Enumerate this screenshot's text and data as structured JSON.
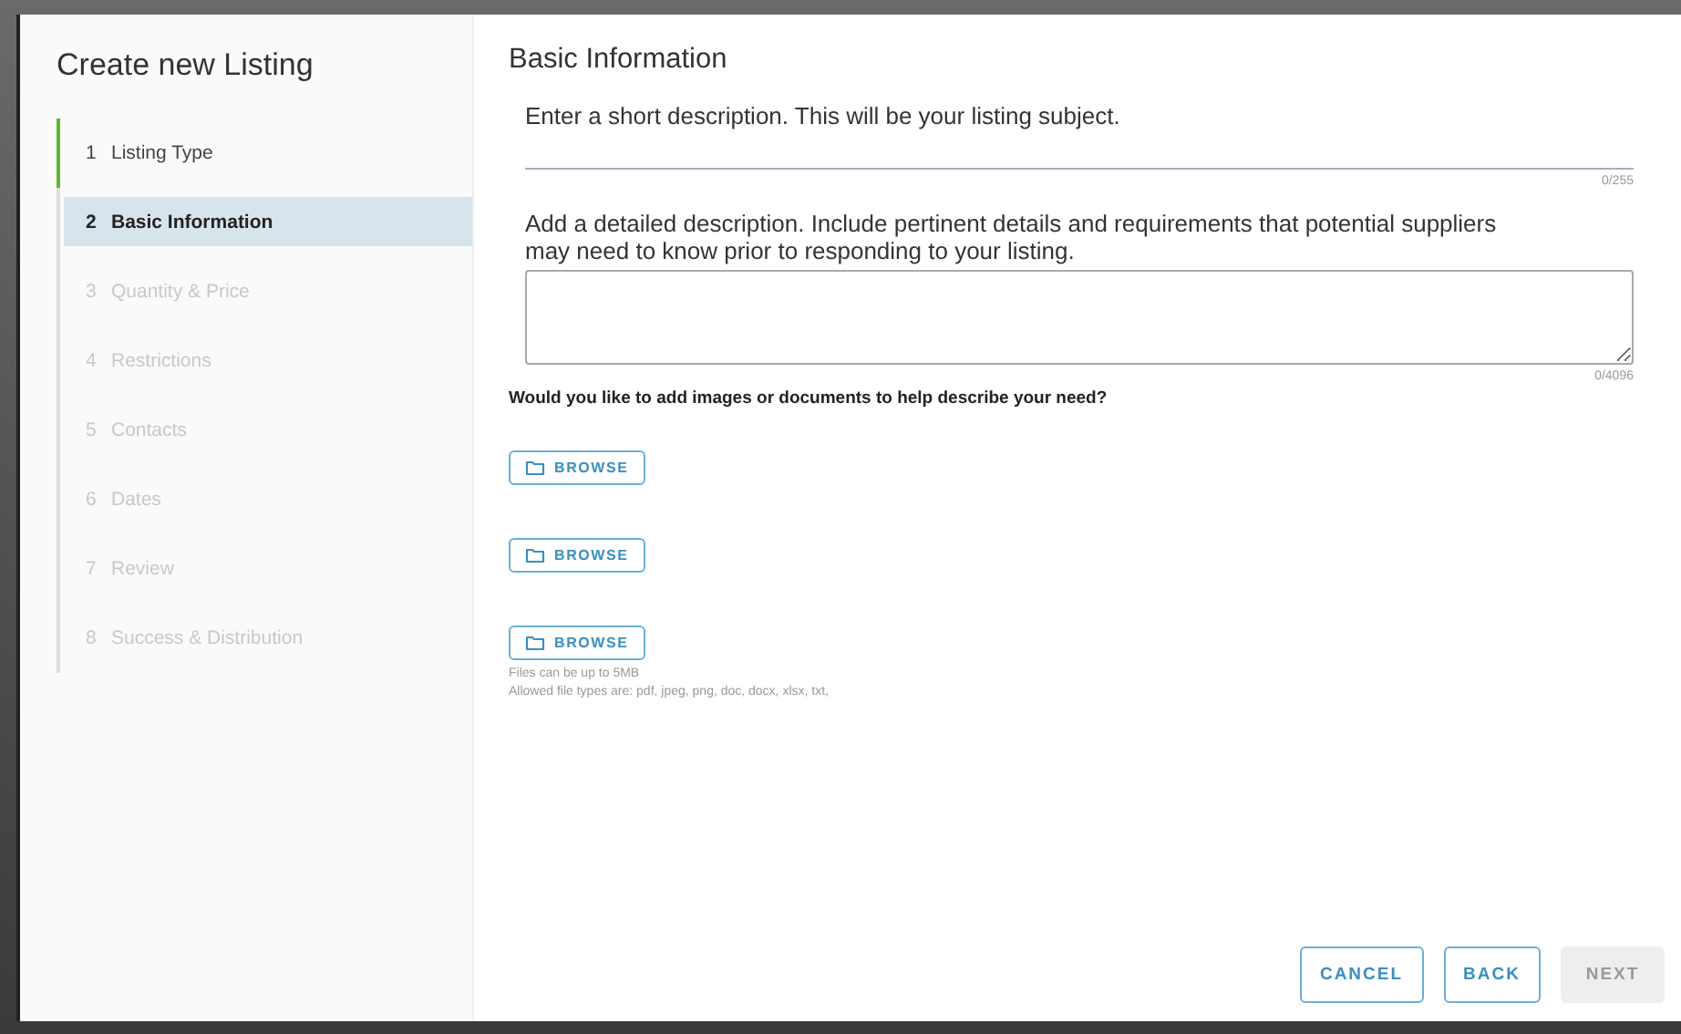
{
  "sidebar": {
    "title": "Create new Listing",
    "steps": [
      {
        "number": "1",
        "label": "Listing Type",
        "completed": true,
        "selected": false,
        "disabled": false
      },
      {
        "number": "2",
        "label": "Basic Information",
        "completed": false,
        "selected": true,
        "disabled": false
      },
      {
        "number": "3",
        "label": "Quantity & Price",
        "completed": false,
        "selected": false,
        "disabled": true
      },
      {
        "number": "4",
        "label": "Restrictions",
        "completed": false,
        "selected": false,
        "disabled": true
      },
      {
        "number": "5",
        "label": "Contacts",
        "completed": false,
        "selected": false,
        "disabled": true
      },
      {
        "number": "6",
        "label": "Dates",
        "completed": false,
        "selected": false,
        "disabled": true
      },
      {
        "number": "7",
        "label": "Review",
        "completed": false,
        "selected": false,
        "disabled": true
      },
      {
        "number": "8",
        "label": "Success & Distribution",
        "completed": false,
        "selected": false,
        "disabled": true
      }
    ]
  },
  "main": {
    "title": "Basic Information",
    "short_description": {
      "label": "Enter a short description. This will be your listing subject.",
      "counter": "0/255"
    },
    "detailed_description": {
      "label": "Add a detailed description. Include pertinent details and requirements that potential suppliers may need to know prior to responding to your listing.",
      "counter": "0/4096"
    },
    "attachments": {
      "question": "Would you like to add images or documents to help describe your need?",
      "buttons": [
        "BROWSE",
        "BROWSE",
        "BROWSE"
      ],
      "notes": [
        "Files can be up to 5MB",
        "Allowed file types are: pdf, jpeg, png, doc, docx, xlsx, txt,"
      ]
    }
  },
  "footer": {
    "buttons": [
      {
        "label": "CANCEL",
        "disabled": false
      },
      {
        "label": "BACK",
        "disabled": false
      },
      {
        "label": "NEXT",
        "disabled": true
      }
    ]
  }
}
